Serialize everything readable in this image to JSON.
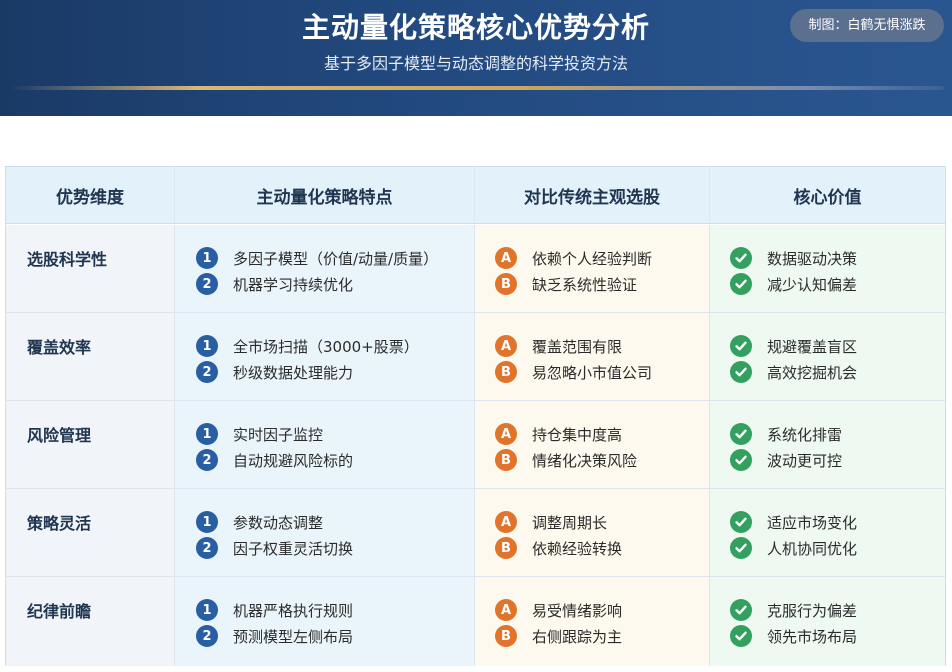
{
  "header": {
    "title": "主动量化策略核心优势分析",
    "subtitle": "基于多因子模型与动态调整的科学投资方法",
    "credit": "制图：白鹤无惧涨跌"
  },
  "table": {
    "columns": [
      "优势维度",
      "主动量化策略特点",
      "对比传统主观选股",
      "核心价值"
    ],
    "rows": [
      {
        "dimension": "选股科学性",
        "features": [
          "多因子模型（价值/动量/质量）",
          "机器学习持续优化"
        ],
        "traditional": [
          "依赖个人经验判断",
          "缺乏系统性验证"
        ],
        "value": [
          "数据驱动决策",
          "减少认知偏差"
        ]
      },
      {
        "dimension": "覆盖效率",
        "features": [
          "全市场扫描（3000+股票）",
          "秒级数据处理能力"
        ],
        "traditional": [
          "覆盖范围有限",
          "易忽略小市值公司"
        ],
        "value": [
          "规避覆盖盲区",
          "高效挖掘机会"
        ]
      },
      {
        "dimension": "风险管理",
        "features": [
          "实时因子监控",
          "自动规避风险标的"
        ],
        "traditional": [
          "持仓集中度高",
          "情绪化决策风险"
        ],
        "value": [
          "系统化排雷",
          "波动更可控"
        ]
      },
      {
        "dimension": "策略灵活",
        "features": [
          "参数动态调整",
          "因子权重灵活切换"
        ],
        "traditional": [
          "调整周期长",
          "依赖经验转换"
        ],
        "value": [
          "适应市场变化",
          "人机协同优化"
        ]
      },
      {
        "dimension": "纪律前瞻",
        "features": [
          "机器严格执行规则",
          "预测模型左侧布局"
        ],
        "traditional": [
          "易受情绪影响",
          "右侧跟踪为主"
        ],
        "value": [
          "克服行为偏差",
          "领先市场布局"
        ]
      }
    ]
  },
  "badges": {
    "numbers": [
      "1",
      "2"
    ],
    "letters": [
      "A",
      "B"
    ],
    "check_icon": "check-icon"
  },
  "colors": {
    "banner": "#1f4478",
    "number_badge": "#2a5ea3",
    "letter_badge": "#e0742a",
    "check_badge": "#33a060",
    "header_bg": "#e3f1fb"
  }
}
